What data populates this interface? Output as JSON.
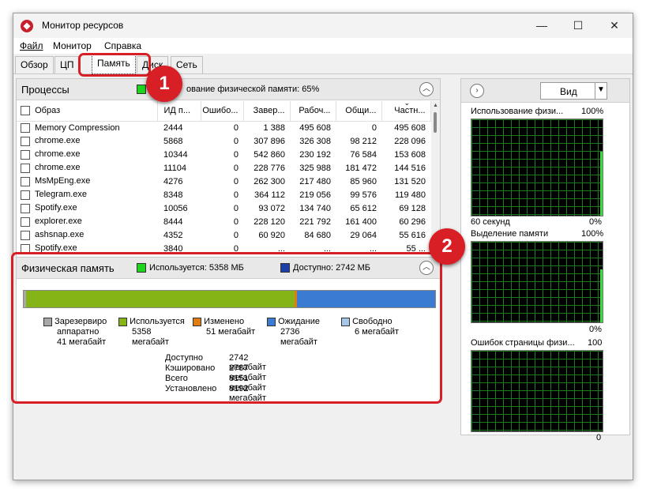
{
  "window": {
    "title": "Монитор ресурсов",
    "icon": "resource-monitor-icon",
    "controls": {
      "minimize": "—",
      "maximize": "☐",
      "close": "✕"
    }
  },
  "menu": [
    "Файл",
    "Монитор",
    "Справка"
  ],
  "tabs": [
    {
      "label": "Обзор",
      "active": false
    },
    {
      "label": "ЦП",
      "active": false
    },
    {
      "label": "Память",
      "active": true
    },
    {
      "label": "Диск",
      "active": false
    },
    {
      "label": "Сеть",
      "active": false
    }
  ],
  "processes": {
    "title": "Процессы",
    "usage_text": "ование физической памяти: 65%",
    "usage_percent": 65,
    "columns": [
      "Образ",
      "ИД п...",
      "Ошибо...",
      "Завер...",
      "Рабоч...",
      "Общи...",
      "Частн..."
    ],
    "rows": [
      [
        "Memory Compression",
        "2444",
        "0",
        "1 388",
        "495 608",
        "0",
        "495 608"
      ],
      [
        "chrome.exe",
        "5868",
        "0",
        "307 896",
        "326 308",
        "98 212",
        "228 096"
      ],
      [
        "chrome.exe",
        "10344",
        "0",
        "542 860",
        "230 192",
        "76 584",
        "153 608"
      ],
      [
        "chrome.exe",
        "11104",
        "0",
        "228 776",
        "325 988",
        "181 472",
        "144 516"
      ],
      [
        "MsMpEng.exe",
        "4276",
        "0",
        "262 300",
        "217 480",
        "85 960",
        "131 520"
      ],
      [
        "Telegram.exe",
        "8348",
        "0",
        "364 112",
        "219 056",
        "99 576",
        "119 480"
      ],
      [
        "Spotify.exe",
        "10056",
        "0",
        "93 072",
        "134 740",
        "65 612",
        "69 128"
      ],
      [
        "explorer.exe",
        "8444",
        "0",
        "228 120",
        "221 792",
        "161 400",
        "60 296"
      ],
      [
        "ashsnap.exe",
        "4352",
        "0",
        "60 920",
        "84 680",
        "29 064",
        "55 616"
      ],
      [
        "Spotify.exe",
        "3840",
        "0",
        "...",
        "...",
        "...",
        "55 ..."
      ]
    ]
  },
  "physical_memory": {
    "title": "Физическая память",
    "in_use_label": "Используется: 5358 МБ",
    "available_label": "Доступно: 2742 МБ",
    "bar_fractions": {
      "reserved": 0.005,
      "in_use": 0.654,
      "modified": 0.006,
      "standby": 0.335,
      "free": 0.0
    },
    "legend": [
      {
        "line1": "Зарезервиро",
        "line2": "аппаратно",
        "line3": "41 мегабайт",
        "color": "#a8a8a8"
      },
      {
        "line1": "Используется",
        "line2": "5358",
        "line3": "мегабайт",
        "color": "#85b417"
      },
      {
        "line1": "Изменено",
        "line2": "51 мегабайт",
        "line3": "",
        "color": "#e07c12"
      },
      {
        "line1": "Ожидание",
        "line2": "2736",
        "line3": "мегабайт",
        "color": "#3b7bd1"
      },
      {
        "line1": "Свободно",
        "line2": "6 мегабайт",
        "line3": "",
        "color": "#a6c6ea"
      }
    ],
    "stats": [
      {
        "label": "Доступно",
        "value": "2742 мегабайт"
      },
      {
        "label": "Кэшировано",
        "value": "2787 мегабайт"
      },
      {
        "label": "Всего",
        "value": "8151 мегабайт"
      },
      {
        "label": "Установлено",
        "value": "8192 мегабайт"
      }
    ]
  },
  "right_pane": {
    "view_label": "Вид",
    "graphs": [
      {
        "title": "Использование физи...",
        "max": "100%",
        "bottom_left": "60 секунд",
        "bottom_right": "0%"
      },
      {
        "title": "Выделение памяти",
        "max": "100%",
        "bottom_left": "",
        "bottom_right": "0%"
      },
      {
        "title": "Ошибок страницы физи...",
        "max": "100",
        "bottom_left": "",
        "bottom_right": "0"
      }
    ]
  },
  "annotations": {
    "badge1": "1",
    "badge2": "2"
  },
  "colors": {
    "accent_red": "#d81f26",
    "in_use_green": "#85b417",
    "available_blue": "#1f3fa8"
  }
}
